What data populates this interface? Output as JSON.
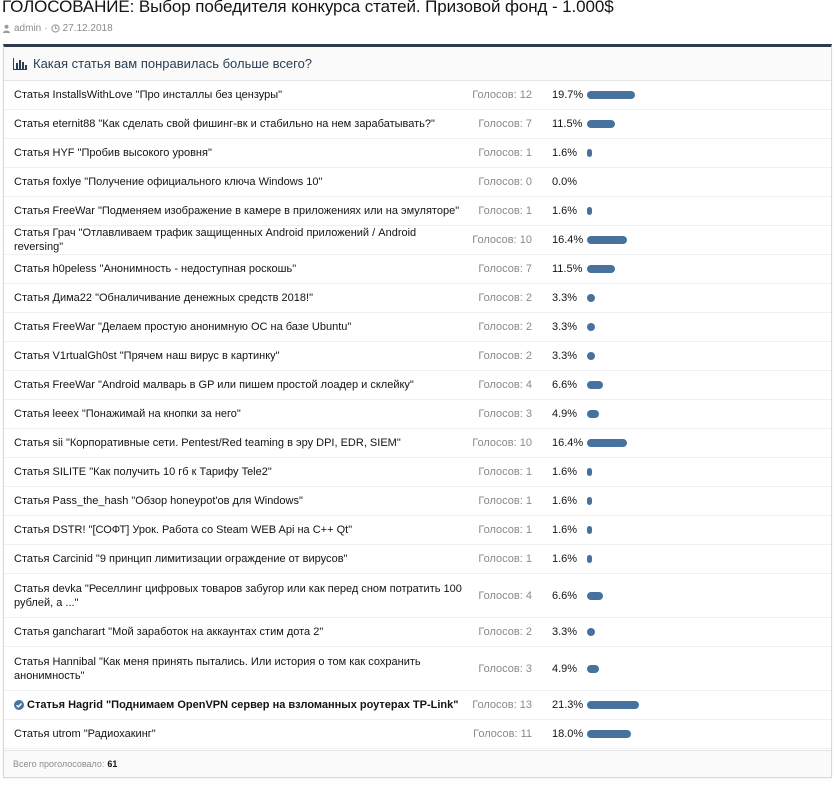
{
  "thread": {
    "title": "ГОЛОСОВАНИЕ: Выбор победителя конкурса статей. Призовой фонд - 1.000$",
    "author": "admin",
    "separator": "·",
    "date": "27.12.2018"
  },
  "poll": {
    "question": "Какая статья вам понравилась больше всего?",
    "votes_prefix": "Голосов:",
    "options": [
      {
        "label": "Статья InstallsWithLove \"Про инсталлы без цензуры\"",
        "votes": "Голосов: 12",
        "percent": "19.7%",
        "share": 19.7
      },
      {
        "label": "Статья eternit88 \"Как сделать свой фишинг-вк и стабильно на нем зарабатывать?\"",
        "votes": "Голосов: 7",
        "percent": "11.5%",
        "share": 11.5
      },
      {
        "label": "Статья HYF \"Пробив высокого уровня\"",
        "votes": "Голосов: 1",
        "percent": "1.6%",
        "share": 1.6
      },
      {
        "label": "Статья foxlye \"Получение официального ключа Windows 10\"",
        "votes": "Голосов: 0",
        "percent": "0.0%",
        "share": 0
      },
      {
        "label": "Статья FreeWar \"Подменяем изображение в камере в приложениях или на эмуляторе\"",
        "votes": "Голосов: 1",
        "percent": "1.6%",
        "share": 1.6
      },
      {
        "label": "Статья Грач \"Отлавливаем трафик защищенных Android приложений / Android reversing\"",
        "votes": "Голосов: 10",
        "percent": "16.4%",
        "share": 16.4
      },
      {
        "label": "Статья h0peless \"Анонимность - недоступная роскошь\"",
        "votes": "Голосов: 7",
        "percent": "11.5%",
        "share": 11.5
      },
      {
        "label": "Статья Дима22 \"Обналичивание денежных средств 2018!\"",
        "votes": "Голосов: 2",
        "percent": "3.3%",
        "share": 3.3
      },
      {
        "label": "Статья FreeWar \"Делаем простую анонимную ОС на базе Ubuntu\"",
        "votes": "Голосов: 2",
        "percent": "3.3%",
        "share": 3.3
      },
      {
        "label": "Статья V1rtualGh0st \"Прячем наш вирус в картинку\"",
        "votes": "Голосов: 2",
        "percent": "3.3%",
        "share": 3.3
      },
      {
        "label": "Статья FreeWar \"Android малварь в GP или пишем простой лоадер и склейку\"",
        "votes": "Голосов: 4",
        "percent": "6.6%",
        "share": 6.6
      },
      {
        "label": "Статья leeex \"Понажимай на кнопки за него\"",
        "votes": "Голосов: 3",
        "percent": "4.9%",
        "share": 4.9
      },
      {
        "label": "Статья sii \"Корпоративные сети. Pentest/Red teaming в эру DPI, EDR, SIEM\"",
        "votes": "Голосов: 10",
        "percent": "16.4%",
        "share": 16.4
      },
      {
        "label": "Статья SILITE \"Как получить 10 гб к Тарифу Tele2\"",
        "votes": "Голосов: 1",
        "percent": "1.6%",
        "share": 1.6
      },
      {
        "label": "Статья Pass_the_hash \"Обзор honeypot'ов для Windows\"",
        "votes": "Голосов: 1",
        "percent": "1.6%",
        "share": 1.6
      },
      {
        "label": "Статья DSTR! \"[СОФТ] Урок. Работа со Steam WEB Api на C++ Qt\"",
        "votes": "Голосов: 1",
        "percent": "1.6%",
        "share": 1.6
      },
      {
        "label": "Статья Carcinid \"9 принцип лимитизации ограждение от вирусов\"",
        "votes": "Голосов: 1",
        "percent": "1.6%",
        "share": 1.6
      },
      {
        "label": "Статья devka \"Реселлинг цифровых товаров забугор или как перед сном потратить 100 рублей, а ...\"",
        "votes": "Голосов: 4",
        "percent": "6.6%",
        "share": 6.6
      },
      {
        "label": "Статья gancharart \"Мой заработок на аккаунтах стим дота 2\"",
        "votes": "Голосов: 2",
        "percent": "3.3%",
        "share": 3.3
      },
      {
        "label": "Статья Hannibal \"Как меня принять пытались. Или история о том как сохранить анонимность\"",
        "votes": "Голосов: 3",
        "percent": "4.9%",
        "share": 4.9
      },
      {
        "label": "Статья Hagrid \"Поднимаем OpenVPN сервер на взломанных роутерах TP-Link\"",
        "votes": "Голосов: 13",
        "percent": "21.3%",
        "share": 21.3,
        "voted": true
      },
      {
        "label": "Статья utrom \"Радиохакинг\"",
        "votes": "Голосов: 11",
        "percent": "18.0%",
        "share": 18.0
      }
    ],
    "footer_label": "Всего проголосовало:",
    "total_votes": "61"
  },
  "colors": {
    "bar": "#47729f",
    "header_border": "#2f3b4c",
    "muted": "#8a8a8a"
  },
  "icons": {
    "author": "user-icon",
    "date": "clock-icon",
    "poll": "bar-chart-icon",
    "voted": "check-circle-icon"
  }
}
